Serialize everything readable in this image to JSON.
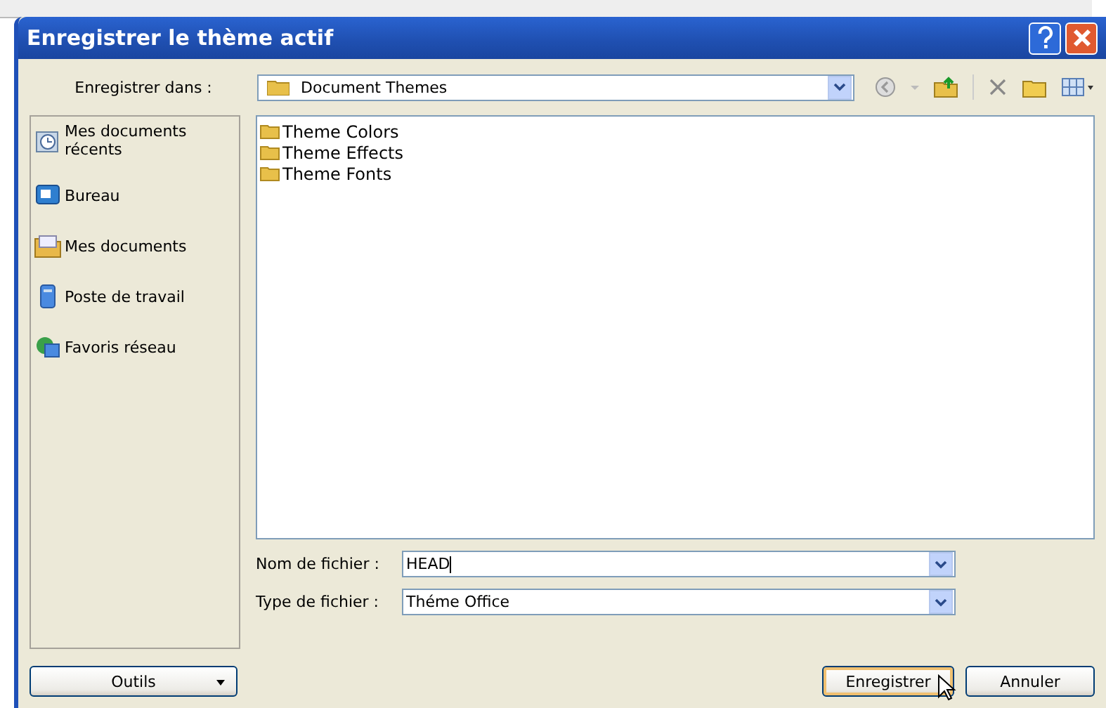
{
  "window": {
    "title": "Enregistrer le thème actif"
  },
  "location": {
    "label": "Enregistrer dans :",
    "value": "Document Themes"
  },
  "places": [
    {
      "label": "Mes documents récents",
      "kind": "recent"
    },
    {
      "label": "Bureau",
      "kind": "desktop"
    },
    {
      "label": "Mes documents",
      "kind": "documents"
    },
    {
      "label": "Poste de travail",
      "kind": "computer"
    },
    {
      "label": "Favoris réseau",
      "kind": "network"
    }
  ],
  "files": [
    {
      "name": "Theme Colors"
    },
    {
      "name": "Theme Effects"
    },
    {
      "name": "Theme Fonts"
    }
  ],
  "filename": {
    "label": "Nom de fichier :",
    "value": "HEAD"
  },
  "filetype": {
    "label": "Type de fichier :",
    "value": "Théme Office"
  },
  "buttons": {
    "tools": "Outils",
    "save": "Enregistrer",
    "cancel": "Annuler"
  }
}
